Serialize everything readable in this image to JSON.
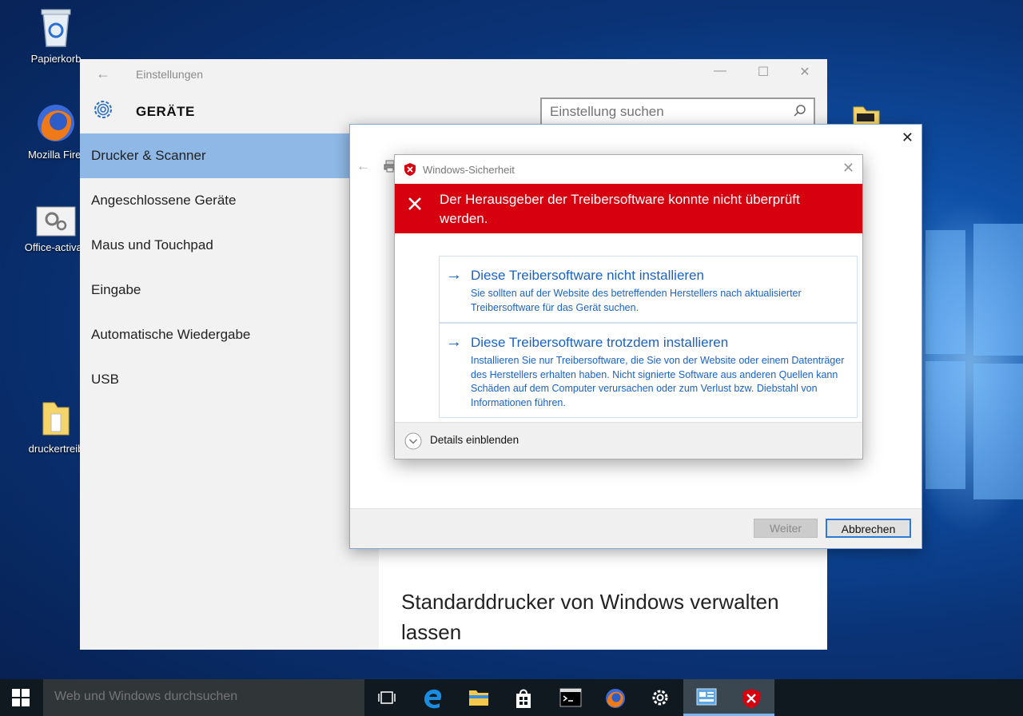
{
  "desktop": {
    "icons": [
      {
        "label": "Papierkorb",
        "icon": "recycle-bin-icon"
      },
      {
        "label": "Mozilla Firef",
        "icon": "firefox-icon"
      },
      {
        "label": "Office-activati",
        "icon": "settings-shortcut-icon"
      },
      {
        "label": "druckertreib",
        "icon": "folder-icon"
      }
    ]
  },
  "settings": {
    "app_title": "Einstellungen",
    "section_title": "GERÄTE",
    "search_placeholder": "Einstellung suchen",
    "nav": [
      {
        "label": "Drucker & Scanner",
        "active": true
      },
      {
        "label": "Angeschlossene Geräte"
      },
      {
        "label": "Maus und Touchpad"
      },
      {
        "label": "Eingabe"
      },
      {
        "label": "Automatische Wiedergabe"
      },
      {
        "label": "USB"
      }
    ],
    "content_text": "Standarddrucker von Windows verwalten lassen"
  },
  "wizard": {
    "buttons": {
      "next": "Weiter",
      "cancel": "Abbrechen"
    }
  },
  "security": {
    "title": "Windows-Sicherheit",
    "warning": "Der Herausgeber der Treibersoftware konnte nicht überprüft werden.",
    "options": [
      {
        "title": "Diese Treibersoftware nicht installieren",
        "desc": "Sie sollten auf der Website des betreffenden Herstellers nach aktualisierter Treibersoftware für das Gerät suchen."
      },
      {
        "title": "Diese Treibersoftware trotzdem installieren",
        "desc": "Installieren Sie nur Treibersoftware, die Sie von der Website oder einem Datenträger des Herstellers erhalten haben. Nicht signierte Software aus anderen Quellen kann Schäden auf dem Computer verursachen oder zum Verlust bzw. Diebstahl von Informationen führen."
      }
    ],
    "details": "Details einblenden"
  },
  "taskbar": {
    "search_placeholder": "Web und Windows durchsuchen",
    "apps": [
      "task-view-icon",
      "edge-icon",
      "file-explorer-icon",
      "store-icon",
      "command-prompt-icon",
      "firefox-icon",
      "settings-icon",
      "control-panel-icon",
      "windows-security-icon"
    ]
  },
  "colors": {
    "accent": "#1a63c4",
    "warning_red": "#d7000f",
    "nav_active": "#8fb8e6",
    "taskbar": "#101820"
  }
}
